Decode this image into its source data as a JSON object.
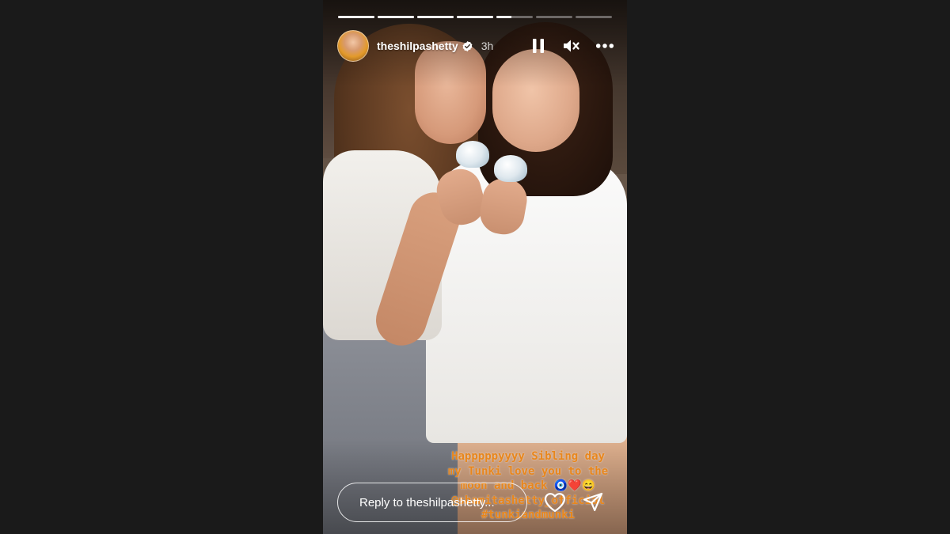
{
  "story": {
    "username": "theshilpashetty",
    "time_ago": "3h",
    "verified": true,
    "progress": {
      "segments": 7,
      "completed": 4,
      "current_fraction": 0.42
    }
  },
  "controls": {
    "pause_icon": "pause-icon",
    "mute_icon": "muted-speaker-icon",
    "more_icon": "more-options-icon"
  },
  "caption": {
    "lines": [
      "Happpppyyyy Sibling day",
      "my Tunki love you to the",
      "moon and back 🧿❤️😄",
      "@shamitashetty_official",
      "#tunkiandmunki"
    ]
  },
  "reply": {
    "placeholder": "Reply to theshilpashetty..."
  },
  "actions": {
    "like_icon": "heart-icon",
    "share_icon": "send-icon"
  },
  "colors": {
    "page_bg": "#1a1a1a",
    "caption_text": "#e8861c",
    "verified_badge": "#ffffff"
  }
}
